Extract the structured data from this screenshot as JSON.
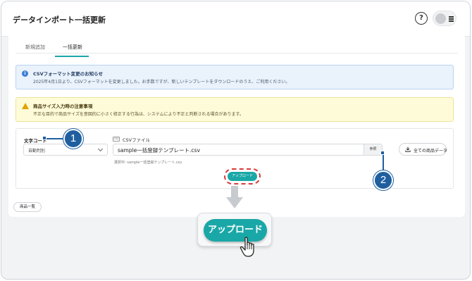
{
  "header": {
    "title": "データインポート一括更新",
    "help_label": "?"
  },
  "tabs": [
    {
      "label": "新規追加",
      "active": false
    },
    {
      "label": "一括更新",
      "active": true
    }
  ],
  "notice": {
    "icon": "info-icon",
    "title": "CSVフォーマット変更のお知らせ",
    "text": "2025年4月1日より、CSVフォーマットを変更しました。お手数ですが、新しいテンプレートをダウンロードのうえ、ご利用ください。"
  },
  "warning": {
    "icon": "warning-icon",
    "title": "商品サイズ入力時の注意事項",
    "text": "不正な目的で商品サイズを意図的に小さく修正する行為は、システムにより不正と判断される場合があります。"
  },
  "form": {
    "charcode_label": "文字コード",
    "charcode_value": "自動判別",
    "csv_tag": "CSV",
    "csv_label": "CSVファイル",
    "csv_value": "sample一括登録テンプレート.csv",
    "browse_label": "参照",
    "selected_note": "選択中: sample一括登録テンプレート.csv",
    "all_data_label": "全ての商品データ",
    "upload_label": "アップロード"
  },
  "footer": {
    "product_list_label": "商品一覧"
  },
  "callouts": {
    "badge_1": "1",
    "badge_2": "2"
  },
  "zoom": {
    "upload_label": "アップロード"
  },
  "colors": {
    "accent": "#1aa7a7",
    "callout": "#1f5fa0",
    "highlight": "#d63a3a",
    "info_bg": "#eaf2fc",
    "warning_bg": "#fefbd9"
  }
}
